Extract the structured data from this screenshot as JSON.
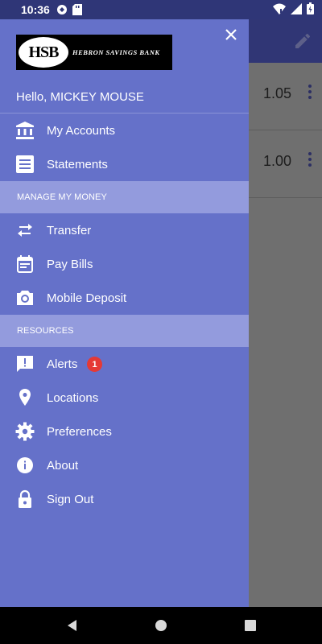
{
  "status_bar": {
    "time": "10:36",
    "icons_left": [
      "sync-icon",
      "sd-card-icon"
    ],
    "icons_right": [
      "wifi-icon",
      "signal-icon",
      "battery-icon"
    ]
  },
  "background": {
    "rows": [
      {
        "amount": "1.05"
      },
      {
        "amount": "1.00"
      }
    ]
  },
  "drawer": {
    "logo": {
      "initials": "HSB",
      "name": "HEBRON SAVINGS BANK"
    },
    "greeting": "Hello,  MICKEY MOUSE",
    "items_main": [
      {
        "label": "My Accounts",
        "icon": "bank-icon"
      },
      {
        "label": "Statements",
        "icon": "statements-icon"
      }
    ],
    "section_money": "MANAGE MY MONEY",
    "items_money": [
      {
        "label": "Transfer",
        "icon": "transfer-icon"
      },
      {
        "label": "Pay Bills",
        "icon": "calendar-icon"
      },
      {
        "label": "Mobile Deposit",
        "icon": "camera-icon"
      }
    ],
    "section_resources": "RESOURCES",
    "items_resources": [
      {
        "label": "Alerts",
        "icon": "alert-icon",
        "badge": "1"
      },
      {
        "label": "Locations",
        "icon": "location-pin-icon"
      },
      {
        "label": "Preferences",
        "icon": "gear-icon"
      },
      {
        "label": "About",
        "icon": "info-icon"
      },
      {
        "label": "Sign Out",
        "icon": "lock-icon"
      }
    ]
  },
  "colors": {
    "drawer_bg": "#6571c9",
    "section_bg": "#939bdd",
    "toolbar_bg": "#303675",
    "badge_bg": "#e53935"
  }
}
